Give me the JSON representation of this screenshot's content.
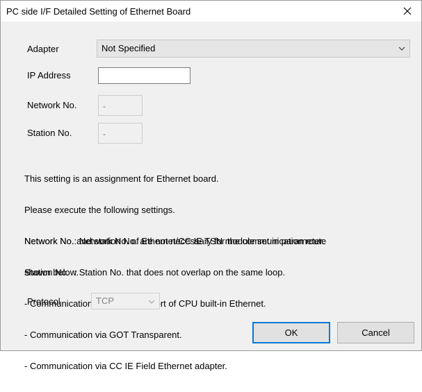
{
  "window": {
    "title": "PC side I/F Detailed Setting of Ethernet Board",
    "close_icon": "close-icon"
  },
  "form": {
    "adapter_label": "Adapter",
    "adapter_value": "Not Specified",
    "ip_label": "IP Address",
    "ip_value": "",
    "network_label": "Network No.",
    "network_value": "-",
    "station_label": "Station No.",
    "station_value": "-",
    "protocol_label": "Protocol",
    "protocol_value": "TCP"
  },
  "info": {
    "block1": [
      "This setting is an assignment for Ethernet board.",
      "Please execute the following settings.",
      "Network No.: Network No. of Ethernet/CC IE TSN module set in parameter.",
      "Station No.  : Station No. that does not overlap on the same loop."
    ],
    "block2": [
      "Network No. and station No. are not necessary for the communication route",
      "shown below.",
      "- Communication with Ethernet port of CPU built-in Ethernet.",
      "- Communication via GOT Transparent.",
      "- Communication via CC IE Field Ethernet adapter."
    ]
  },
  "buttons": {
    "ok": "OK",
    "cancel": "Cancel"
  },
  "colors": {
    "accent": "#0078d7",
    "dialog_bg": "#f0f0f0"
  }
}
